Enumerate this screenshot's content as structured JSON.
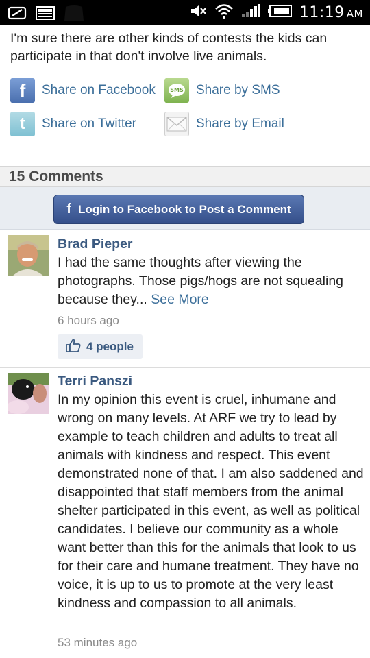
{
  "status_bar": {
    "time": "11:19",
    "ampm": "AM",
    "icons": [
      "notification-icon",
      "image-icon",
      "app-icon",
      "mute-icon",
      "wifi-icon",
      "signal-icon",
      "battery-icon"
    ]
  },
  "article": {
    "intro_text": "I'm sure there are other kinds of contests the kids can participate in that don't involve live animals."
  },
  "share": {
    "facebook": "Share on Facebook",
    "sms": "Share by SMS",
    "twitter": "Share on Twitter",
    "email": "Share by Email"
  },
  "comments": {
    "header": "15 Comments",
    "login_button": "Login to Facebook to Post a Comment",
    "items": [
      {
        "author": "Brad Pieper",
        "text": "I had the same thoughts after viewing the photographs. Those pigs/hogs are not squealing because they...",
        "see_more": "See More",
        "time": "6 hours ago",
        "likes": "4 people"
      },
      {
        "author": "Terri Panszi",
        "text": "In my opinion this event is cruel, inhumane and wrong on many levels. At ARF we try to lead by example to teach children and adults to treat all animals with kindness and respect. This event demonstrated none of that. I am also saddened and disappointed that staff members from the animal shelter participated in this event, as well as political candidates. I believe our community as a whole want better than this for the animals that look to us for their care and humane treatment. They have no voice, it is up to us to promote at the very least kindness and compassion to all animals.",
        "time": "53 minutes ago"
      }
    ]
  },
  "colors": {
    "link": "#3b6e99",
    "author": "#3b5a80",
    "facebook_blue": "#3b5998"
  }
}
